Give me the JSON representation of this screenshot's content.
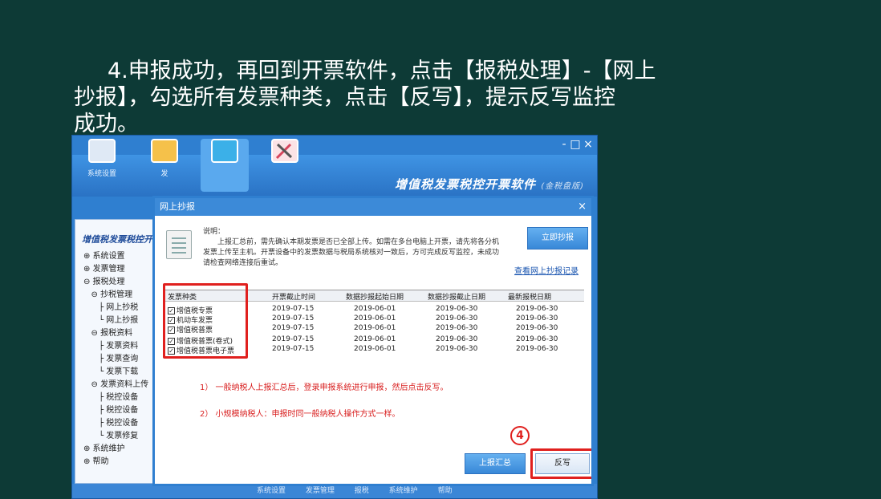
{
  "slide": {
    "line1": "4.申报成功，再回到开票软件，点击【报税处理】-【网上",
    "line2": "抄报】，勾选所有发票种类，点击【反写】，提示反写监控",
    "line3": "成功。"
  },
  "app": {
    "brand": "增值税发票税控开票软件",
    "brand_sub": "(金税盘版)",
    "toolbar": [
      {
        "label": "系统设置",
        "color": "#e65c3a"
      },
      {
        "label": "发",
        "color": "#f5c14a"
      },
      {
        "label": "",
        "color": "#3bb0e8"
      },
      {
        "label": "",
        "color": "#d6455c"
      }
    ],
    "window_controls": [
      "-",
      "□",
      "×"
    ],
    "tree": {
      "title": "增值税发票税控开",
      "items": [
        "⊕ 系统设置",
        "⊕ 发票管理",
        "⊖ 报税处理",
        "   ⊖ 抄税管理",
        "      ├ 网上抄税",
        "      └ 网上抄报",
        "   ⊖ 报税资料",
        "      ├ 发票资料",
        "      ├ 发票查询",
        "      └ 发票下载",
        "   ⊖ 发票资料上传",
        "      ├ 税控设备",
        "      ├ 税控设备",
        "      ├ 税控设备",
        "      └ 发票修复",
        "⊕ 系统维护",
        "⊕ 帮助"
      ]
    },
    "status_items": [
      "系统设置",
      "发票管理",
      "报税",
      "系统维护",
      "帮助"
    ]
  },
  "dialog": {
    "title": "网上抄报",
    "close": "×",
    "note_title": "说明：",
    "note_body": "上报汇总前，需先确认本期发票是否已全部上传。如需在多台电脑上开票，请先将各分机发票上传至主机。开票设备中的发票数据与税局系统核对一致后，方可完成反写监控，未成功请检查网络连接后重试。",
    "btn_report": "立即抄报",
    "link_text": "查看网上抄报记录",
    "columns": [
      "发票种类",
      "开票截止时间",
      "数据抄报起始日期",
      "数据抄报截止日期",
      "最新报税日期"
    ],
    "rows": [
      {
        "name": "增值税专票",
        "a": "2019-07-15",
        "b": "2019-06-01",
        "c": "2019-06-30",
        "d": "2019-06-30"
      },
      {
        "name": "机动车发票",
        "a": "2019-07-15",
        "b": "2019-06-01",
        "c": "2019-06-30",
        "d": "2019-06-30"
      },
      {
        "name": "增值税普票",
        "a": "2019-07-15",
        "b": "2019-06-01",
        "c": "2019-06-30",
        "d": "2019-06-30"
      },
      {
        "name": "增值税普票(卷式)",
        "a": "2019-07-15",
        "b": "2019-06-01",
        "c": "2019-06-30",
        "d": "2019-06-30"
      },
      {
        "name": "增值税普票电子票",
        "a": "2019-07-15",
        "b": "2019-06-01",
        "c": "2019-06-30",
        "d": "2019-06-30"
      }
    ],
    "note1": "1） 一般纳税人上报汇总后，登录申报系统进行申报，然后点击反写。",
    "note2": "2） 小规模纳税人：申报时同一般纳税人操作方式一样。",
    "step": "4",
    "btn_upload": "上报汇总",
    "btn_writeback": "反写",
    "accent": "#e0201e"
  }
}
